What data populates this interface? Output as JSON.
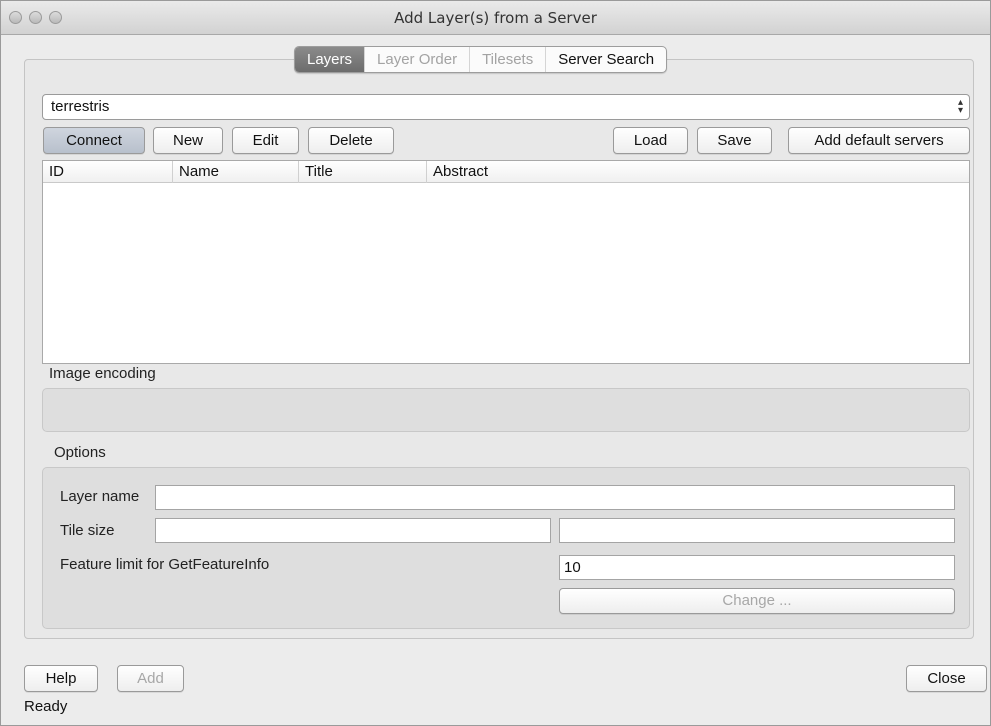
{
  "window": {
    "title": "Add Layer(s) from a Server"
  },
  "tabs": [
    {
      "label": "Layers",
      "active": true
    },
    {
      "label": "Layer Order",
      "active": false
    },
    {
      "label": "Tilesets",
      "active": false
    },
    {
      "label": "Server Search",
      "active": false
    }
  ],
  "connection": {
    "selected": "terrestris"
  },
  "buttons": {
    "connect": "Connect",
    "new": "New",
    "edit": "Edit",
    "delete": "Delete",
    "load": "Load",
    "save": "Save",
    "add_default": "Add default servers"
  },
  "table": {
    "columns": [
      "ID",
      "Name",
      "Title",
      "Abstract"
    ],
    "rows": []
  },
  "image_encoding": {
    "label": "Image encoding"
  },
  "options": {
    "label": "Options",
    "layer_name_label": "Layer name",
    "layer_name_value": "",
    "tile_size_label": "Tile size",
    "tile_width_value": "",
    "tile_height_value": "",
    "feature_limit_label": "Feature limit for GetFeatureInfo",
    "feature_limit_value": "10",
    "change_label": "Change ..."
  },
  "footer": {
    "help": "Help",
    "add": "Add",
    "close": "Close",
    "status": "Ready"
  },
  "colors": {
    "active_tab": "#7a7a7a",
    "window_bg": "#ececec",
    "panel_bg": "#dedede"
  }
}
